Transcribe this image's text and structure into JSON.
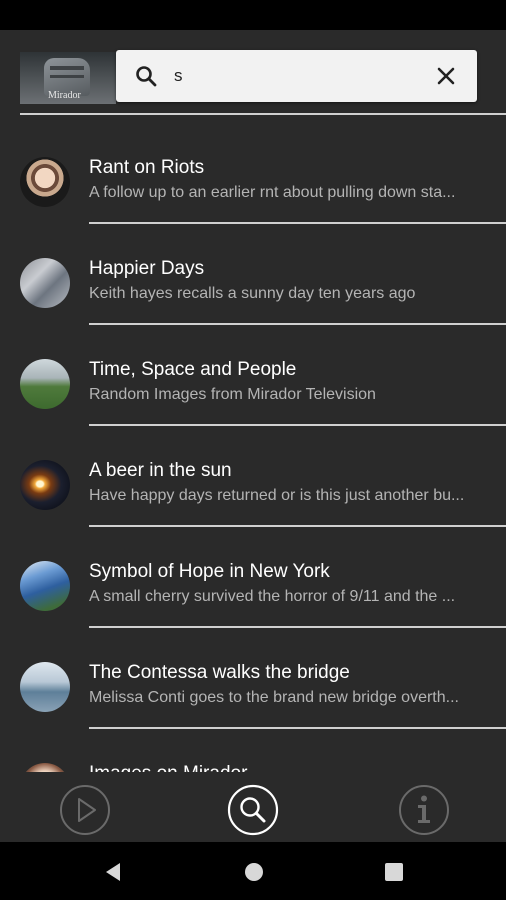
{
  "app": {
    "logo_text": "Mirador"
  },
  "search": {
    "value": "s",
    "search_icon": "search-icon",
    "clear_icon": "close-icon"
  },
  "results": [
    {
      "title": "Rant on Riots",
      "subtitle": "A follow up to an earlier rnt about pulling down sta..."
    },
    {
      "title": "Happier Days",
      "subtitle": "Keith hayes recalls a sunny day ten years ago"
    },
    {
      "title": "Time, Space and People",
      "subtitle": "Random Images from Mirador Television"
    },
    {
      "title": "A beer in the sun",
      "subtitle": "Have happy days returned or is this just another bu..."
    },
    {
      "title": "Symbol of Hope in New York",
      "subtitle": "A small cherry survived the horror of 9/11 and the ..."
    },
    {
      "title": "The Contessa walks the bridge",
      "subtitle": "Melissa Conti goes to the brand new bridge overth..."
    },
    {
      "title": "Images on Mirador",
      "subtitle": ""
    }
  ],
  "bottom_nav": {
    "play": "play-icon",
    "search": "search-icon",
    "info": "info-icon"
  },
  "system_nav": {
    "back": "back-icon",
    "home": "home-icon",
    "recents": "recents-icon"
  },
  "colors": {
    "background": "#2a2a2a",
    "search_box": "#f2f2f2",
    "title_text": "#ffffff",
    "subtitle_text": "#b4b4b4",
    "divider": "#cfcfcf"
  }
}
